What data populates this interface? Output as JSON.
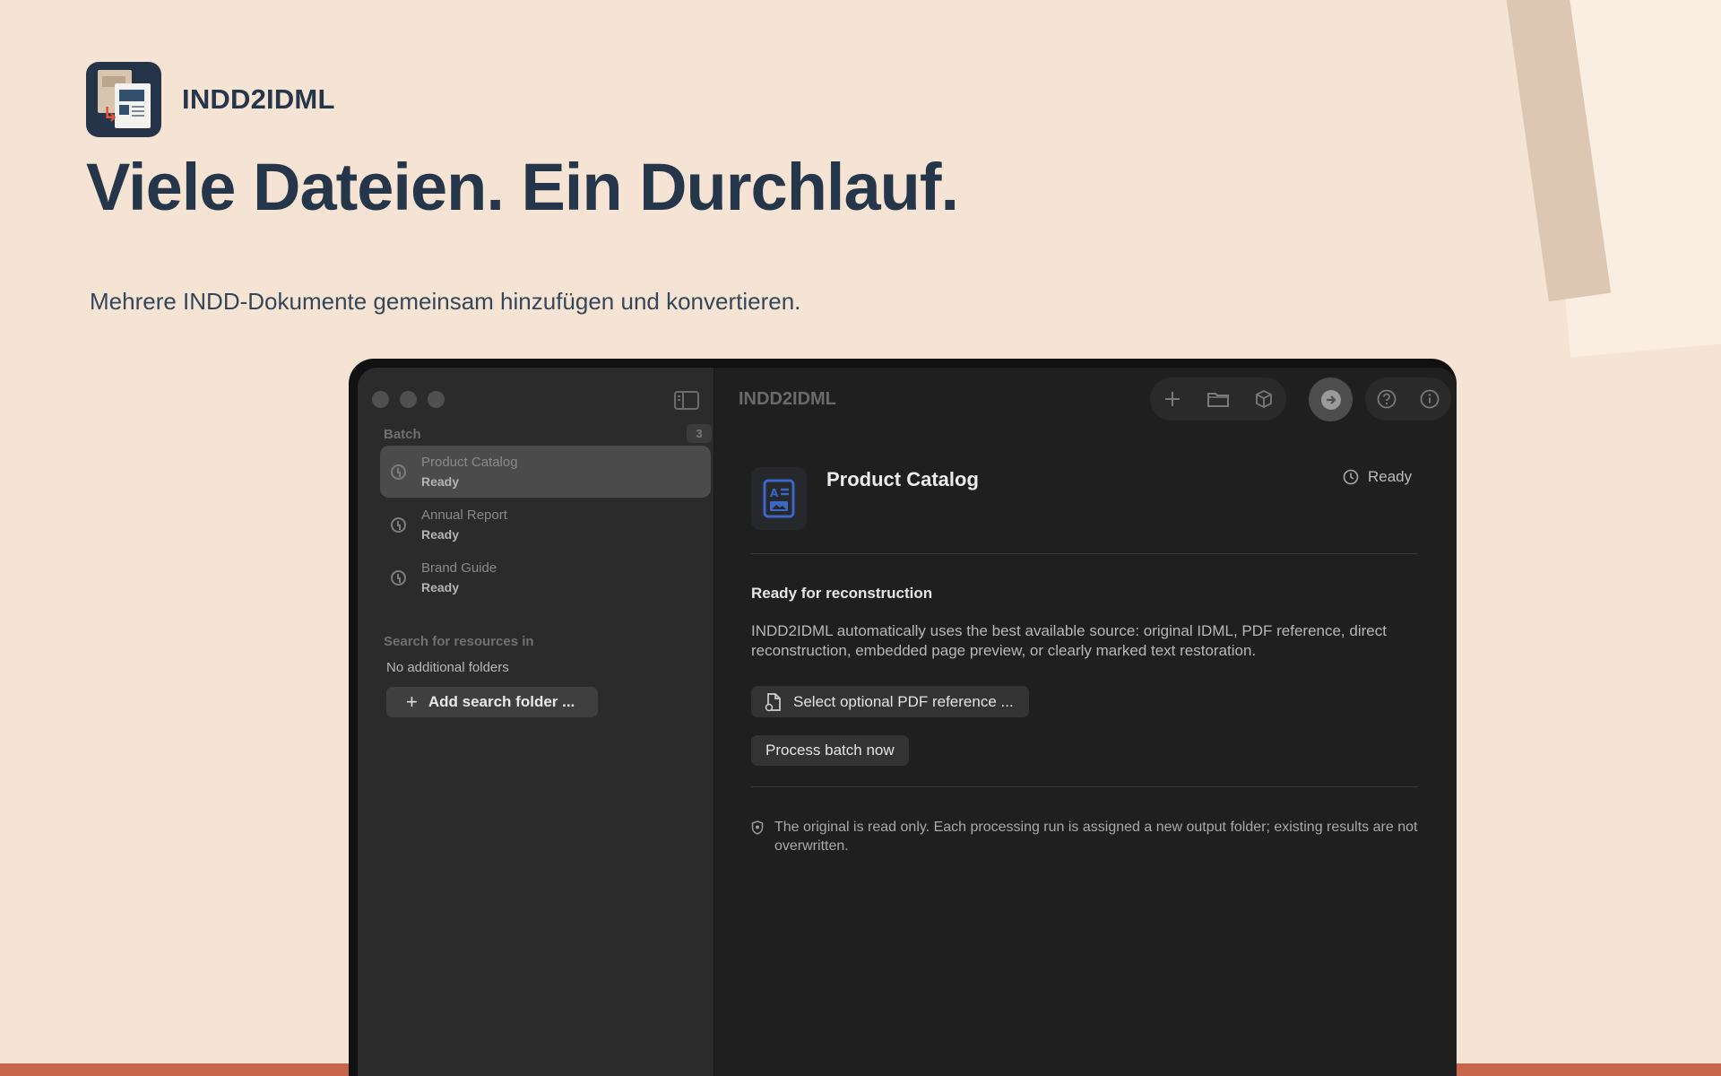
{
  "brand": {
    "name": "INDD2IDML",
    "icon": "app-logo-icon"
  },
  "hero": {
    "headline": "Viele Dateien. Ein Durchlauf.",
    "subline": "Mehrere INDD-Dokumente gemeinsam hinzufügen und konvertieren."
  },
  "colors": {
    "background": "#f5e4d3",
    "text": "#26364a",
    "accent_band": "#c8664c",
    "window": "#1f1f20",
    "sidebar": "#2b2b2c"
  },
  "window": {
    "toolbar_title": "INDD2IDML",
    "toolbar_icons": [
      "plus-icon",
      "folder-icon",
      "package-icon",
      "arrow-right-circle-icon",
      "help-icon",
      "info-icon"
    ]
  },
  "sidebar": {
    "batch_label": "Batch",
    "batch_count": "3",
    "items": [
      {
        "title": "Product Catalog",
        "status": "Ready",
        "selected": true
      },
      {
        "title": "Annual Report",
        "status": "Ready",
        "selected": false
      },
      {
        "title": "Brand Guide",
        "status": "Ready",
        "selected": false
      }
    ],
    "search_label": "Search for resources in",
    "no_folders": "No additional folders",
    "add_folder_label": "Add search folder ..."
  },
  "detail": {
    "title": "Product Catalog",
    "status": "Ready",
    "section_title": "Ready for reconstruction",
    "description": "INDD2IDML automatically uses the best available source: original IDML, PDF reference, direct reconstruction, embedded page preview, or clearly marked text restoration.",
    "pdf_button": "Select optional PDF reference ...",
    "process_button": "Process batch now",
    "footnote": "The original is read only. Each processing run is assigned a new output folder; existing results are not overwritten."
  }
}
